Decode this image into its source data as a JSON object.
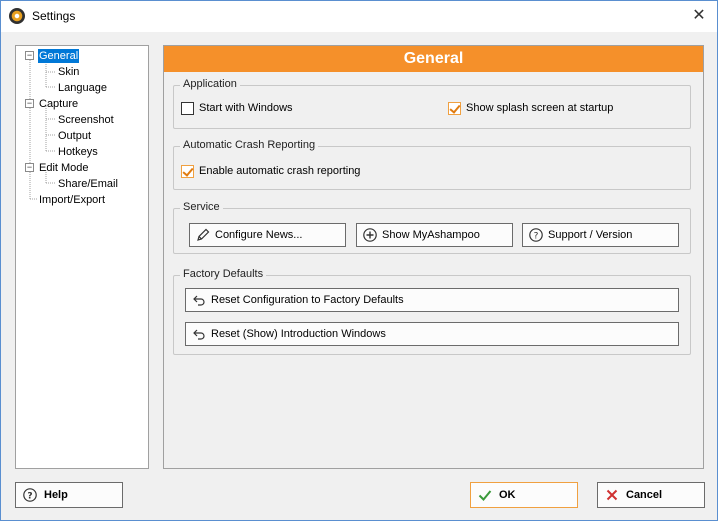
{
  "window": {
    "title": "Settings",
    "close_glyph": "✕"
  },
  "tree": {
    "items": [
      {
        "label": "General",
        "level": 0,
        "selected": true,
        "expandable": true
      },
      {
        "label": "Skin",
        "level": 1
      },
      {
        "label": "Language",
        "level": 1
      },
      {
        "label": "Capture",
        "level": 0,
        "expandable": true
      },
      {
        "label": "Screenshot",
        "level": 1
      },
      {
        "label": "Output",
        "level": 1
      },
      {
        "label": "Hotkeys",
        "level": 1
      },
      {
        "label": "Edit Mode",
        "level": 0,
        "expandable": true
      },
      {
        "label": "Share/Email",
        "level": 1
      },
      {
        "label": "Import/Export",
        "level": 0
      }
    ],
    "toggle_glyph": "−"
  },
  "content": {
    "header": "General",
    "application": {
      "title": "Application",
      "start_with_windows": {
        "label": "Start with Windows",
        "checked": false
      },
      "splash_screen": {
        "label": "Show splash screen at startup",
        "checked": true
      }
    },
    "crash": {
      "title": "Automatic Crash Reporting",
      "enable": {
        "label": "Enable automatic crash reporting",
        "checked": true
      }
    },
    "service": {
      "title": "Service",
      "configure_news": "Configure News...",
      "show_myashampoo": "Show MyAshampoo",
      "support_version": "Support / Version"
    },
    "factory": {
      "title": "Factory Defaults",
      "reset_config": "Reset Configuration to Factory Defaults",
      "reset_intro": "Reset (Show) Introduction Windows"
    }
  },
  "footer": {
    "help": "Help",
    "ok": "OK",
    "cancel": "Cancel"
  },
  "colors": {
    "accent": "#f5902a",
    "selection": "#0078d7",
    "ok_green": "#3a9a3a",
    "cancel_red": "#d03030"
  }
}
